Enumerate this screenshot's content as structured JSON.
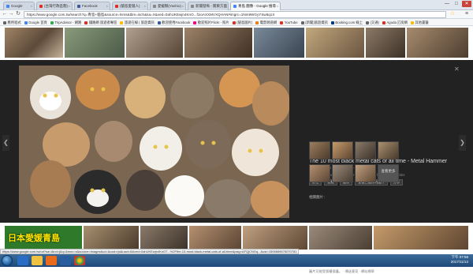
{
  "tabs": [
    {
      "label": "Google",
      "color": "#4285f4"
    },
    {
      "label": "(台灣行政區劃)",
      "color": "#d93025"
    },
    {
      "label": "Facebook",
      "color": "#3b5998"
    },
    {
      "label": "(貓島愛貓人)",
      "color": "#d93025"
    },
    {
      "label": "愛媛縣(Yashio)",
      "color": "#888"
    },
    {
      "label": "新聞發佈 - 關東方面",
      "color": "#888"
    },
    {
      "label": "青島 圖像 - Google 搜尋",
      "color": "#4285f4"
    }
  ],
  "window_controls": {
    "minimize": "—",
    "maximize": "□",
    "close": "✕"
  },
  "address": "https://www.google.com.tw/search?q=青島+貓島&source=lnms&tbm=isch&sa=X&ved=0ahUKEwjn4KnO...f1ioAXXMVXQHAN#imgrc=1Nm9WGyYSw6q1X",
  "bookmarks": [
    {
      "label": "應用程式",
      "color": "#5f6368"
    },
    {
      "label": "Google 首頁",
      "color": "#4285f4"
    },
    {
      "label": "TripAdvisor - 網路",
      "color": "#34a853"
    },
    {
      "label": "鐵路網 旅遊者專區",
      "color": "#d93025"
    },
    {
      "label": "旅遊在線 | 旅遊資訊",
      "color": "#fbbc05"
    },
    {
      "label": "歡迎使用Facebook",
      "color": "#3b5998"
    },
    {
      "label": "歡迎照片Flickr - 照片",
      "color": "#ff0084"
    },
    {
      "label": "(貓島圖片)",
      "color": "#d93025"
    },
    {
      "label": "電影頻道網",
      "color": "#e67e22"
    },
    {
      "label": "YouTube",
      "color": "#e52d27"
    },
    {
      "label": "(新聞)旅遊資訊",
      "color": "#666"
    },
    {
      "label": "Booking.com 線上",
      "color": "#003580"
    },
    {
      "label": "(交通)",
      "color": "#666"
    },
    {
      "label": "Agoda 訂房網",
      "color": "#d93025"
    },
    {
      "label": "其他書籤",
      "color": "#fbbc05"
    }
  ],
  "viewer": {
    "title": "The 10 most black metal cats of all time - Metal Hammer",
    "source": "teamrock.com - 1200 × 720 - 以圖搜尋",
    "description": "Twitter has spoken. These are the ultimate black metal kitties",
    "actions": [
      "前往",
      "瀏覽",
      "儲存",
      "查看已儲存的圖片",
      "分享"
    ],
    "related_label": "相關圖片：",
    "more_label": "查看更多",
    "footnote": "圖片可能受版權保護。 · 傳送意見 · 網站標章",
    "close": "✕",
    "prev": "❮",
    "next": "❯"
  },
  "banner_text": "日本愛媛青島",
  "status_url": "https://www.google.com.tw/url?sa=i&rct=j&q=&esrc=s&source=images&cd=&cad=rja&uact=8&ved=0ahUKEwjn4KnO7...%2Fthe-10-most-black-metal-cats-of-all-time&psig=AFQjCNGq...&ust=1506669676070781",
  "clock": {
    "time": "下午 07:58",
    "date": "2017/11/13"
  }
}
